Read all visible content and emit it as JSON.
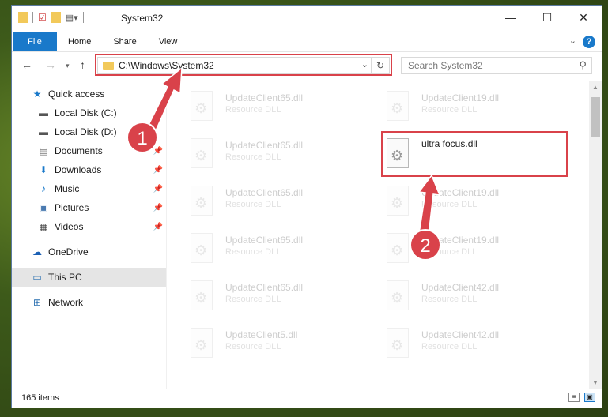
{
  "window": {
    "title": "System32",
    "controls": {
      "minimize": "—",
      "maximize": "☐",
      "close": "✕"
    }
  },
  "ribbon": {
    "tabs": [
      "File",
      "Home",
      "Share",
      "View"
    ],
    "help": "?"
  },
  "nav": {
    "address": "C:\\Windows\\System32",
    "search_placeholder": "Search System32"
  },
  "sidebar": {
    "items": [
      {
        "label": "Quick access",
        "icon": "star-icon",
        "color": "#1979ca"
      },
      {
        "label": "Local Disk (C:)",
        "icon": "drive-icon"
      },
      {
        "label": "Local Disk (D:)",
        "icon": "drive-icon"
      },
      {
        "label": "Documents",
        "icon": "documents-icon"
      },
      {
        "label": "Downloads",
        "icon": "download-icon"
      },
      {
        "label": "Music",
        "icon": "music-icon"
      },
      {
        "label": "Pictures",
        "icon": "pictures-icon"
      },
      {
        "label": "Videos",
        "icon": "videos-icon"
      },
      {
        "label": "OneDrive",
        "icon": "cloud-icon"
      },
      {
        "label": "This PC",
        "icon": "computer-icon",
        "selected": true
      },
      {
        "label": "Network",
        "icon": "network-icon"
      }
    ]
  },
  "files": {
    "left": [
      {
        "name": "UpdateClient65.dll",
        "type": "Resource DLL"
      },
      {
        "name": "UpdateClient65.dll",
        "type": "Resource DLL"
      },
      {
        "name": "UpdateClient65.dll",
        "type": "Resource DLL"
      },
      {
        "name": "UpdateClient65.dll",
        "type": "Resource DLL"
      },
      {
        "name": "UpdateClient65.dll",
        "type": "Resource DLL"
      },
      {
        "name": "UpdateClient5.dll",
        "type": "Resource DLL"
      }
    ],
    "right": [
      {
        "name": "UpdateClient19.dll",
        "type": "Resource DLL"
      },
      {
        "name": "ultra focus.dll",
        "type": "",
        "highlight": true
      },
      {
        "name": "UpdateClient19.dll",
        "type": "Resource DLL"
      },
      {
        "name": "UpdateClient19.dll",
        "type": "Resource DLL"
      },
      {
        "name": "UpdateClient42.dll",
        "type": "Resource DLL"
      },
      {
        "name": "UpdateClient42.dll",
        "type": "Resource DLL"
      }
    ]
  },
  "status": {
    "count": "165 items"
  },
  "annotations": {
    "badge1": "1",
    "badge2": "2",
    "color": "#d9424a"
  }
}
